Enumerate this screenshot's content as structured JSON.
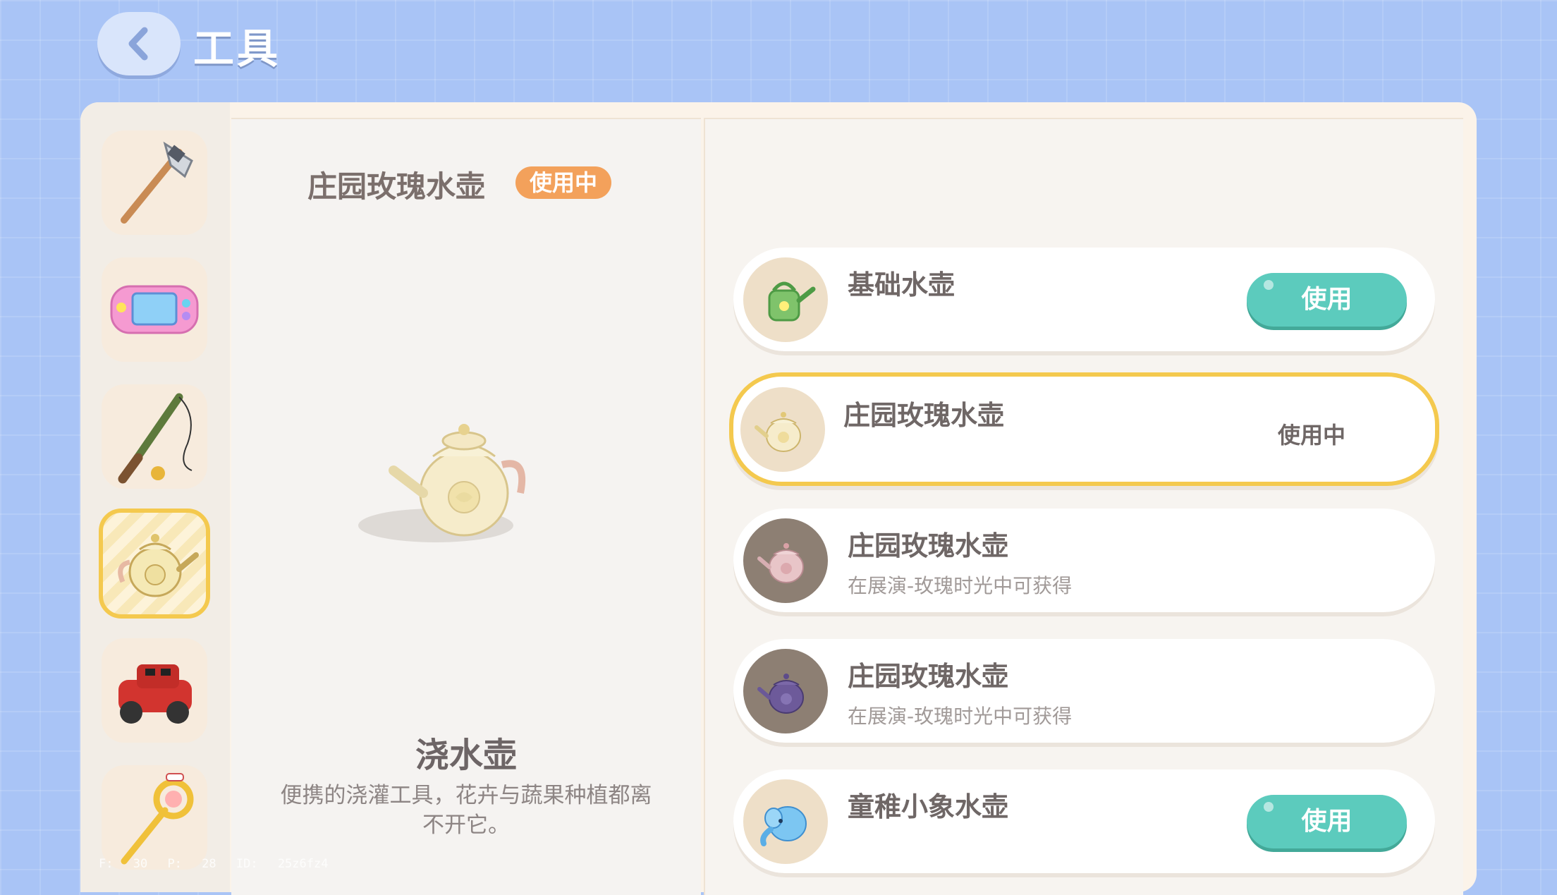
{
  "header": {
    "title": "工具",
    "back_icon": "chevron-left-icon"
  },
  "sidebar": {
    "tools": [
      {
        "icon": "axe-icon"
      },
      {
        "icon": "game-console-icon"
      },
      {
        "icon": "fishing-rod-icon"
      },
      {
        "icon": "watering-can-icon",
        "active": true
      },
      {
        "icon": "toy-car-icon"
      },
      {
        "icon": "magic-wand-icon"
      }
    ]
  },
  "debug": {
    "fps": "F: 30",
    "ping": "P: 28",
    "id": "ID: 25z6fz4"
  },
  "detail": {
    "selected_name": "庄园玫瑰水壶",
    "status_badge": "使用中",
    "category_title": "浇水壶",
    "category_desc": "便携的浇灌工具，花卉与蔬果种植都离不开它。"
  },
  "items": [
    {
      "name": "基础水壶",
      "action": "使用",
      "thumb": "green-watering-can-icon"
    },
    {
      "name": "庄园玫瑰水壶",
      "status": "使用中",
      "selected": true,
      "thumb": "cream-rose-teapot-icon"
    },
    {
      "name": "庄园玫瑰水壶",
      "subtitle": "在展演-玫瑰时光中可获得",
      "thumb": "pink-rose-teapot-icon"
    },
    {
      "name": "庄园玫瑰水壶",
      "subtitle": "在展演-玫瑰时光中可获得",
      "thumb": "purple-rose-teapot-icon"
    },
    {
      "name": "童稚小象水壶",
      "action": "使用",
      "thumb": "blue-elephant-can-icon"
    }
  ],
  "colors": {
    "accent_teal": "#5ccbbd",
    "selected_gold": "#f4c94e",
    "badge_orange": "#f3a15b"
  }
}
